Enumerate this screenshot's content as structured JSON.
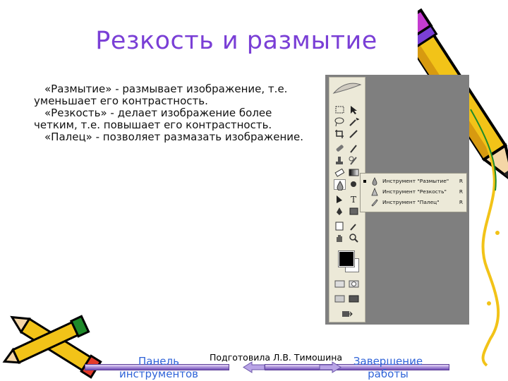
{
  "slide": {
    "title": "Резкость и размытие",
    "paragraphs": [
      "«Размытие» - размывает изображение, т.е. уменьшает его контрастность.",
      "«Резкость» - делает изображение более четким, т.е. повышает его контрастность.",
      "«Палец» - позволяет размазать изображение."
    ]
  },
  "screenshot": {
    "flyout": [
      {
        "label": "Инструмент \"Размытие\"",
        "key": "R",
        "icon": "blur-drop-icon"
      },
      {
        "label": "Инструмент \"Резкость\"",
        "key": "R",
        "icon": "sharpen-cone-icon"
      },
      {
        "label": "Инструмент \"Палец\"",
        "key": "R",
        "icon": "smudge-finger-icon"
      }
    ]
  },
  "footer": {
    "left_nav": "Панель инструментов",
    "author": "Подготовила Л.В. Тимошина",
    "right_nav": "Завершение работы"
  },
  "colors": {
    "title": "#7a3fd6",
    "nav_link": "#2f63d8",
    "nav_bar": "#a58ad6"
  }
}
